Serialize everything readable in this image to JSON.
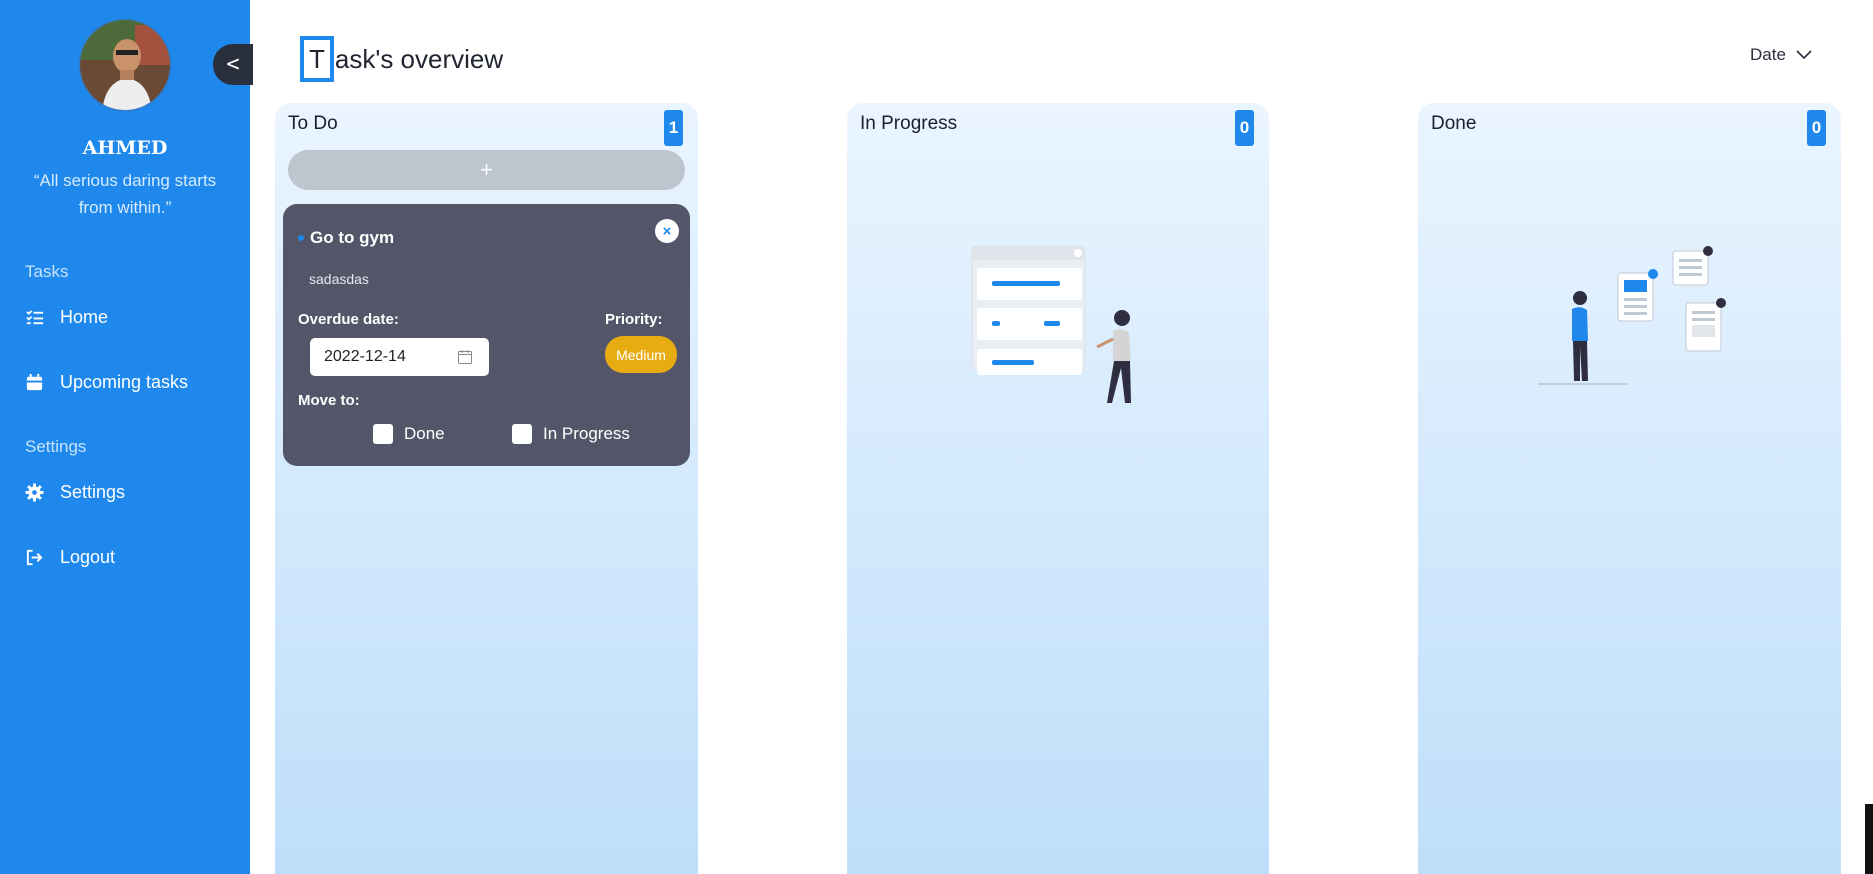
{
  "sidebar": {
    "user_name": "AHMED",
    "quote": "“All serious daring starts from within.”",
    "collapse_label": "<",
    "sections": {
      "tasks_label": "Tasks",
      "settings_label": "Settings"
    },
    "items": {
      "home": "Home",
      "upcoming": "Upcoming tasks",
      "settings": "Settings",
      "logout": "Logout"
    }
  },
  "header": {
    "title_first": "T",
    "title_rest": "ask's overview",
    "sort_label": "Date"
  },
  "columns": [
    {
      "title": "To Do",
      "count": "1",
      "add_label": "+"
    },
    {
      "title": "In Progress",
      "count": "0"
    },
    {
      "title": "Done",
      "count": "0"
    }
  ],
  "task": {
    "title": "Go to gym",
    "description": "sadasdas",
    "due_label": "Overdue date:",
    "due_value": "2022-12-14",
    "priority_label": "Priority:",
    "priority_value": "Medium",
    "move_label": "Move to:",
    "move_options": [
      "Done",
      "In Progress"
    ],
    "close_label": "×"
  },
  "colors": {
    "accent": "#1e88ed",
    "card": "#535669",
    "priority_medium": "#e8ac13"
  }
}
